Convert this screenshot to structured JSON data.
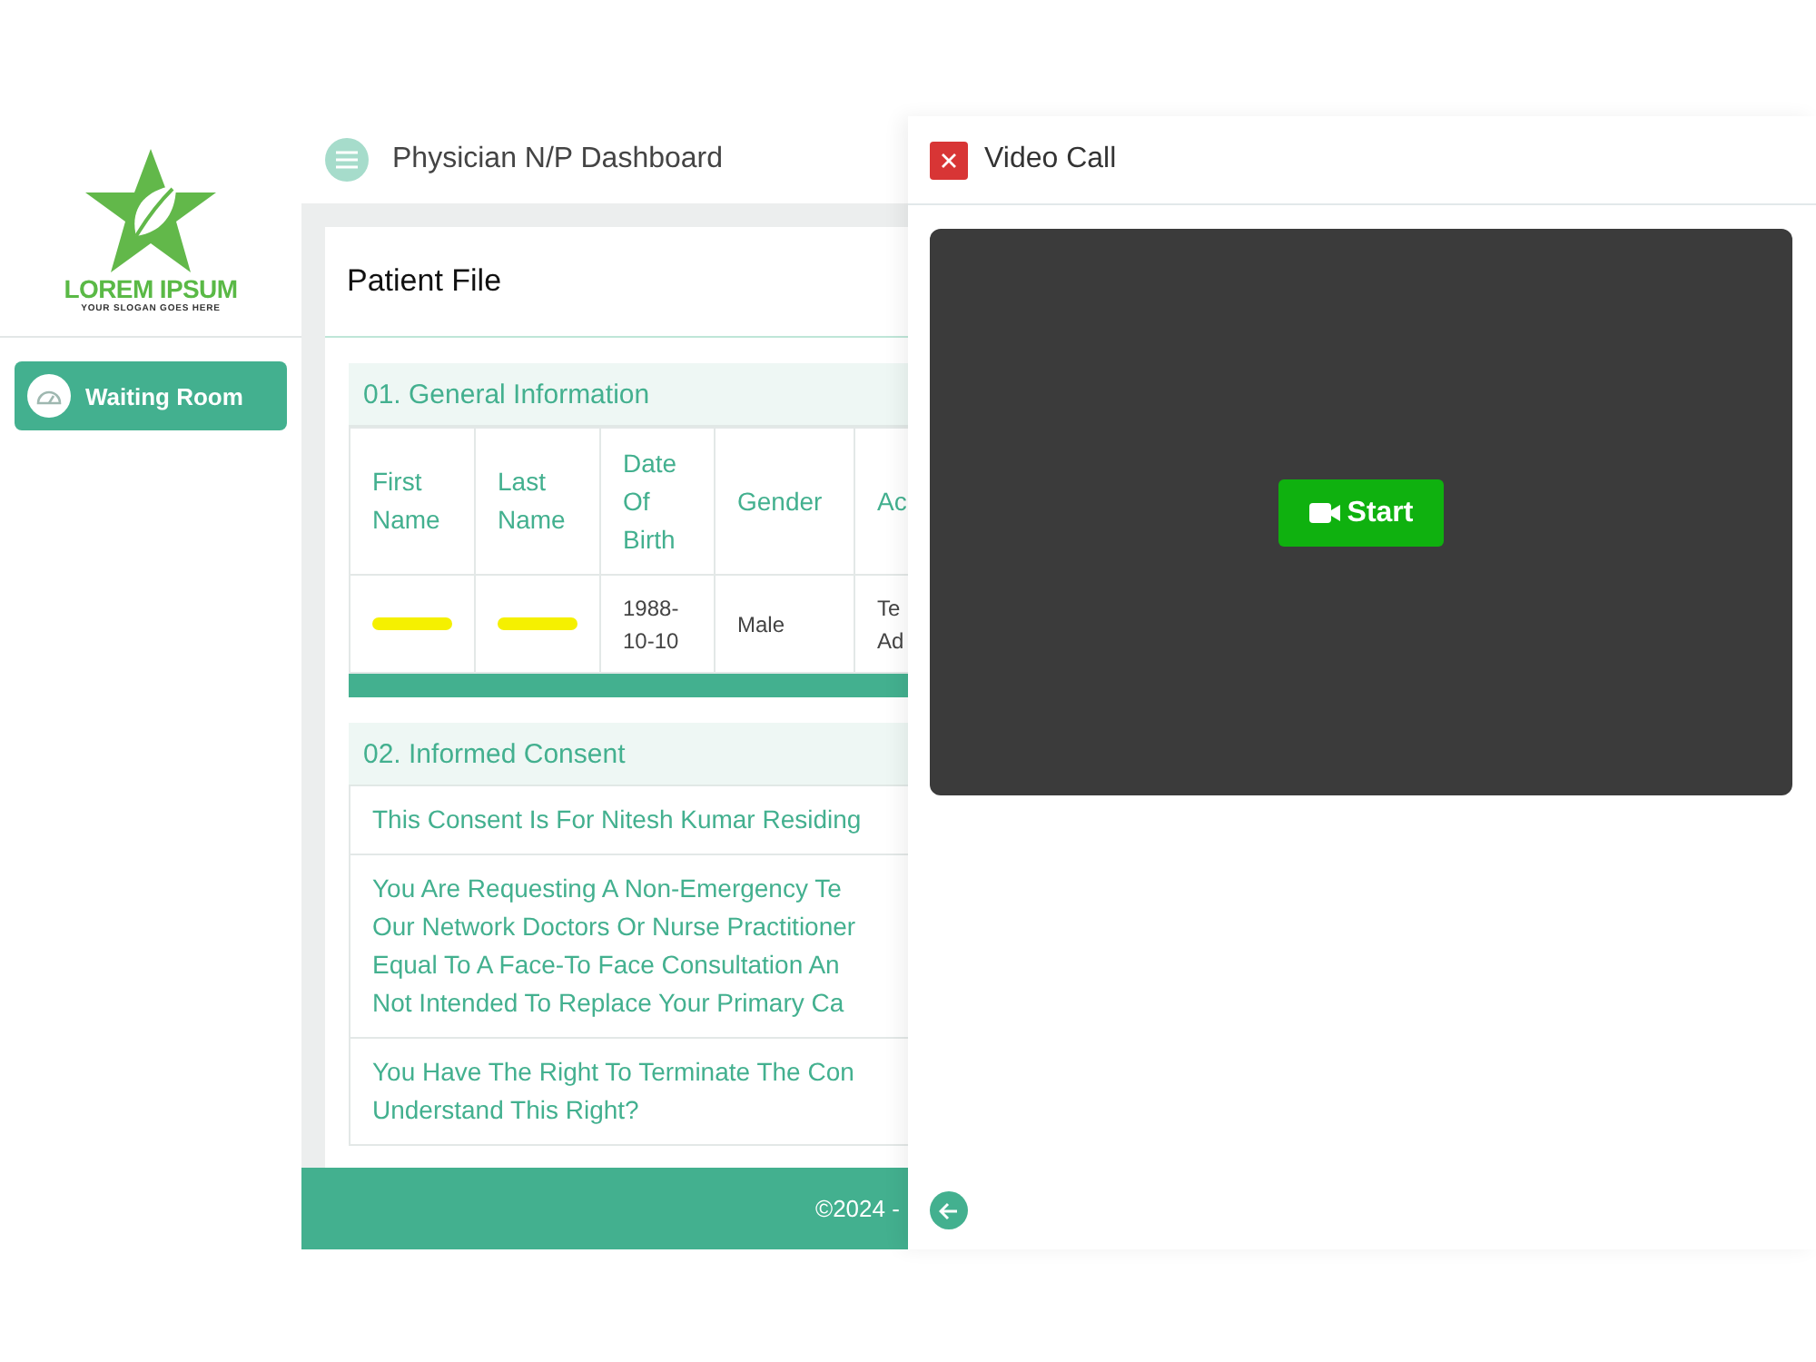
{
  "logo": {
    "name": "LOREM IPSUM",
    "slogan": "YOUR SLOGAN GOES HERE"
  },
  "sidebar": {
    "items": [
      {
        "label": "Waiting Room",
        "selected": true
      }
    ]
  },
  "header": {
    "title": "Physician N/P Dashboard"
  },
  "patient_file": {
    "title": "Patient File",
    "general_information": {
      "title": "01. General Information",
      "columns": [
        "First Name",
        "Last Name",
        "Date Of Birth",
        "Gender",
        "Ac"
      ],
      "rows": [
        [
          {
            "kind": "redacted"
          },
          {
            "kind": "redacted"
          },
          {
            "kind": "text",
            "text": "1988-10-10"
          },
          {
            "kind": "text",
            "text": "Male"
          },
          {
            "kind": "text",
            "text": "Te Ad"
          }
        ]
      ]
    },
    "informed_consent": {
      "title": "02. Informed Consent",
      "items": [
        [
          "This Consent Is For Nitesh Kumar Residing"
        ],
        [
          "You Are Requesting A Non-Emergency Te",
          "Our Network Doctors Or Nurse Practitioner",
          "Equal To A Face-To Face Consultation An",
          "Not Intended To Replace Your Primary Ca"
        ],
        [
          "You Have The Right To Terminate The Con",
          "Understand This Right?"
        ]
      ]
    }
  },
  "footer": {
    "text": "©2024 -"
  },
  "video_call": {
    "title": "Video Call",
    "start_button": "Start"
  }
}
